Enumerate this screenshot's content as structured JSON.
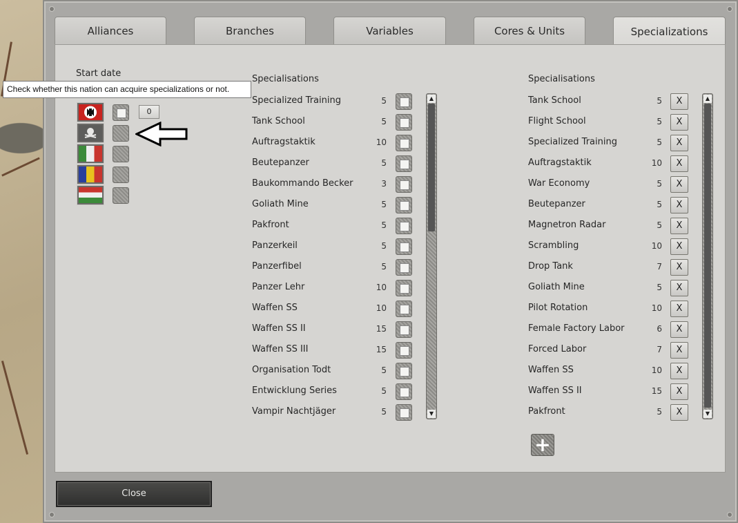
{
  "tabs": [
    {
      "label": "Alliances",
      "active": false
    },
    {
      "label": "Branches",
      "active": false
    },
    {
      "label": "Variables",
      "active": false
    },
    {
      "label": "Cores & Units",
      "active": false
    },
    {
      "label": "Specializations",
      "active": true
    }
  ],
  "left": {
    "start_date_label": "Start date",
    "tooltip": "Check whether this nation can acquire specializations or not.",
    "count_value": "0",
    "nations": [
      {
        "flag_icon": "germany-flag-icon",
        "checked": true
      },
      {
        "flag_icon": "ss-skull-flag-icon",
        "checked": false
      },
      {
        "flag_icon": "italy-flag-icon",
        "checked": false
      },
      {
        "flag_icon": "romania-flag-icon",
        "checked": false
      },
      {
        "flag_icon": "hungary-flag-icon",
        "checked": false
      }
    ]
  },
  "middle": {
    "header": "Specialisations",
    "items": [
      {
        "name": "Specialized Training",
        "cost": "5"
      },
      {
        "name": "Tank School",
        "cost": "5"
      },
      {
        "name": "Auftragstaktik",
        "cost": "10"
      },
      {
        "name": "Beutepanzer",
        "cost": "5"
      },
      {
        "name": "Baukommando Becker",
        "cost": "3"
      },
      {
        "name": "Goliath Mine",
        "cost": "5"
      },
      {
        "name": "Pakfront",
        "cost": "5"
      },
      {
        "name": "Panzerkeil",
        "cost": "5"
      },
      {
        "name": "Panzerfibel",
        "cost": "5"
      },
      {
        "name": "Panzer Lehr",
        "cost": "10"
      },
      {
        "name": "Waffen SS",
        "cost": "10"
      },
      {
        "name": "Waffen SS II",
        "cost": "15"
      },
      {
        "name": "Waffen SS III",
        "cost": "15"
      },
      {
        "name": "Organisation Todt",
        "cost": "5"
      },
      {
        "name": "Entwicklung Series",
        "cost": "5"
      },
      {
        "name": "Vampir Nachtjäger",
        "cost": "5"
      }
    ]
  },
  "right": {
    "header": "Specialisations",
    "remove_label": "X",
    "add_label": "+",
    "items": [
      {
        "name": "Tank School",
        "cost": "5"
      },
      {
        "name": "Flight School",
        "cost": "5"
      },
      {
        "name": "Specialized Training",
        "cost": "5"
      },
      {
        "name": "Auftragstaktik",
        "cost": "10"
      },
      {
        "name": "War Economy",
        "cost": "5"
      },
      {
        "name": "Beutepanzer",
        "cost": "5"
      },
      {
        "name": "Magnetron Radar",
        "cost": "5"
      },
      {
        "name": "Scrambling",
        "cost": "10"
      },
      {
        "name": "Drop Tank",
        "cost": "7"
      },
      {
        "name": "Goliath Mine",
        "cost": "5"
      },
      {
        "name": "Pilot Rotation",
        "cost": "10"
      },
      {
        "name": "Female Factory Labor",
        "cost": "6"
      },
      {
        "name": "Forced Labor",
        "cost": "7"
      },
      {
        "name": "Waffen SS",
        "cost": "10"
      },
      {
        "name": "Waffen SS II",
        "cost": "15"
      },
      {
        "name": "Pakfront",
        "cost": "5"
      }
    ]
  },
  "footer": {
    "close_label": "Close"
  }
}
